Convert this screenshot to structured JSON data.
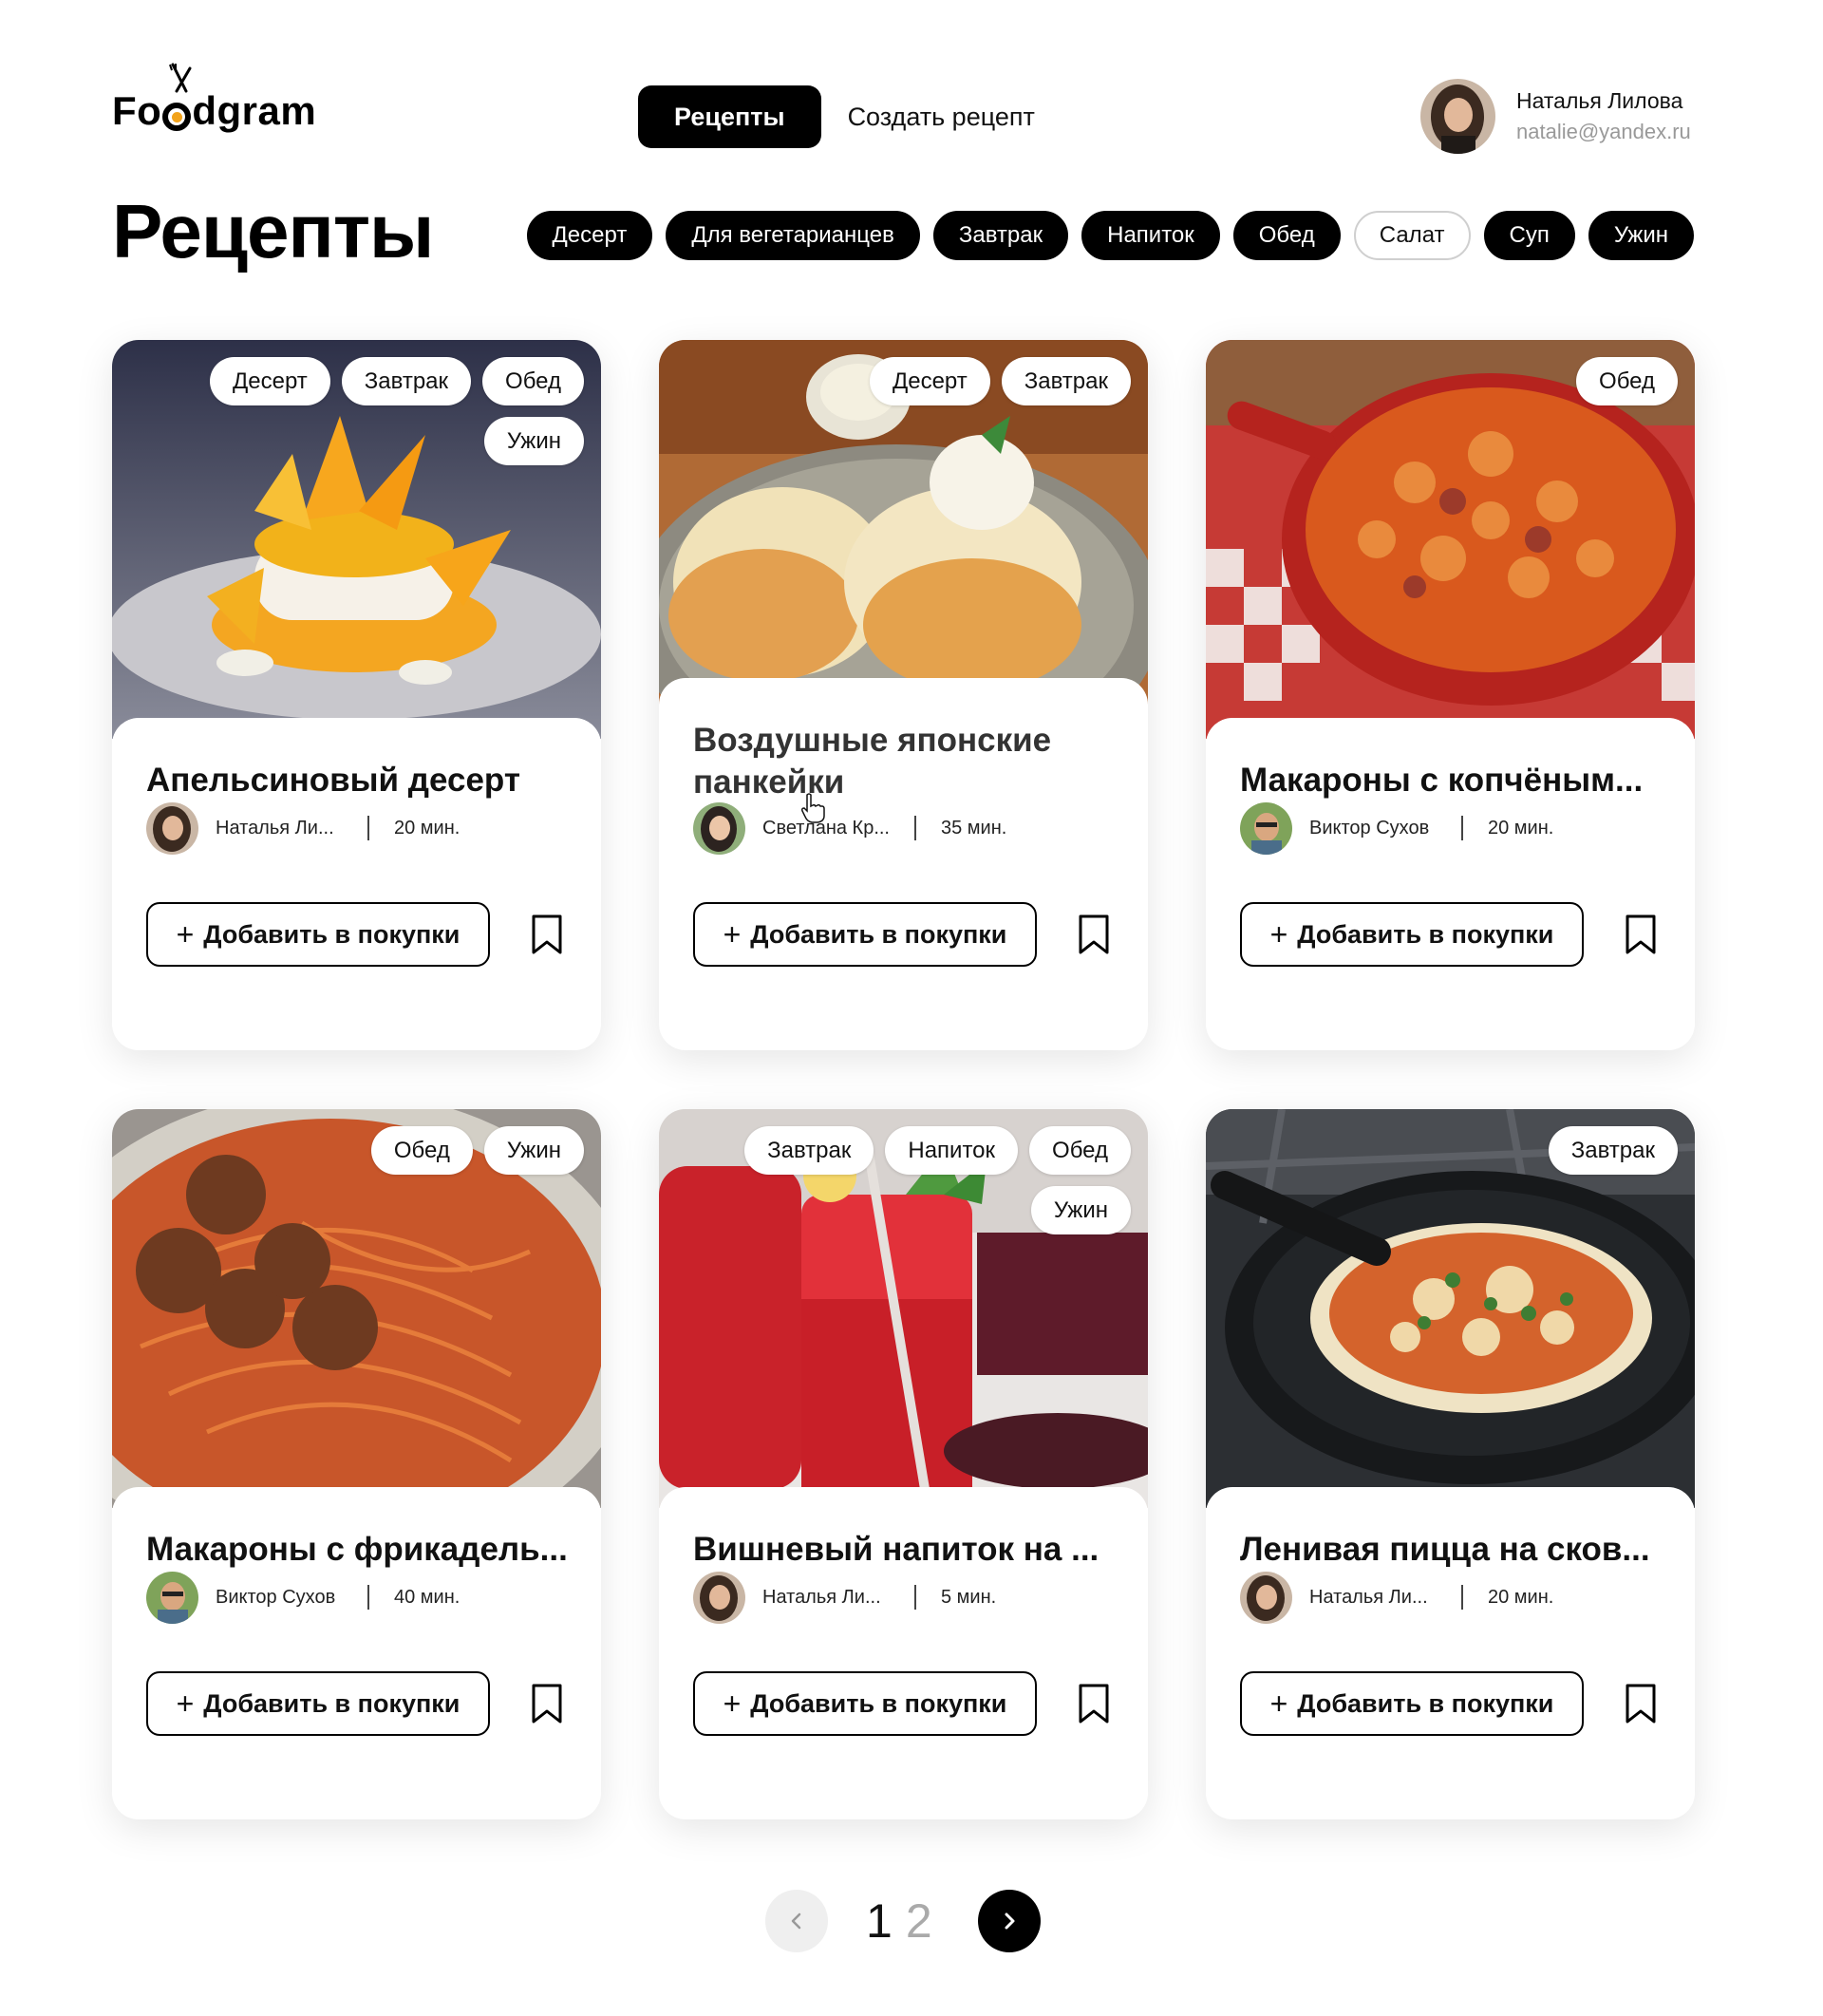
{
  "header": {
    "logo_text_left": "Fo",
    "logo_text_right": "dgram",
    "nav": {
      "active_label": "Рецепты",
      "link_label": "Создать рецепт"
    },
    "user": {
      "name": "Наталья Лилова",
      "email": "natalie@yandex.ru"
    }
  },
  "page": {
    "title": "Рецепты",
    "filters": [
      {
        "label": "Десерт",
        "active": true
      },
      {
        "label": "Для вегетарианцев",
        "active": true
      },
      {
        "label": "Завтрак",
        "active": true
      },
      {
        "label": "Напиток",
        "active": true
      },
      {
        "label": "Обед",
        "active": true
      },
      {
        "label": "Салат",
        "active": false
      },
      {
        "label": "Суп",
        "active": true
      },
      {
        "label": "Ужин",
        "active": true
      }
    ]
  },
  "cards": [
    {
      "title": "Апельсиновый десерт",
      "tags": [
        "Десерт",
        "Завтрак",
        "Обед",
        "Ужин"
      ],
      "author": "Наталья Ли...",
      "time": "20 мин.",
      "buy_label": "Добавить в покупки"
    },
    {
      "title": "Воздушные японские панкейки",
      "tags": [
        "Десерт",
        "Завтрак"
      ],
      "author": "Светлана Кр...",
      "time": "35 мин.",
      "buy_label": "Добавить в покупки"
    },
    {
      "title": "Макароны с копчёным...",
      "tags": [
        "Обед"
      ],
      "author": "Виктор Сухов",
      "time": "20 мин.",
      "buy_label": "Добавить в покупки"
    },
    {
      "title": "Макароны с фрикадель...",
      "tags": [
        "Обед",
        "Ужин"
      ],
      "author": "Виктор Сухов",
      "time": "40 мин.",
      "buy_label": "Добавить в покупки"
    },
    {
      "title": "Вишневый напиток на ...",
      "tags": [
        "Завтрак",
        "Напиток",
        "Обед",
        "Ужин"
      ],
      "author": "Наталья Ли...",
      "time": "5 мин.",
      "buy_label": "Добавить в покупки"
    },
    {
      "title": "Ленивая пицца на сков...",
      "tags": [
        "Завтрак"
      ],
      "author": "Наталья Ли...",
      "time": "20 мин.",
      "buy_label": "Добавить в покупки"
    }
  ],
  "pagination": {
    "pages": [
      "1",
      "2"
    ],
    "current": "1"
  },
  "colors": {
    "primary": "#000000",
    "muted": "#999999",
    "accent_logo": "#f2a31b"
  }
}
